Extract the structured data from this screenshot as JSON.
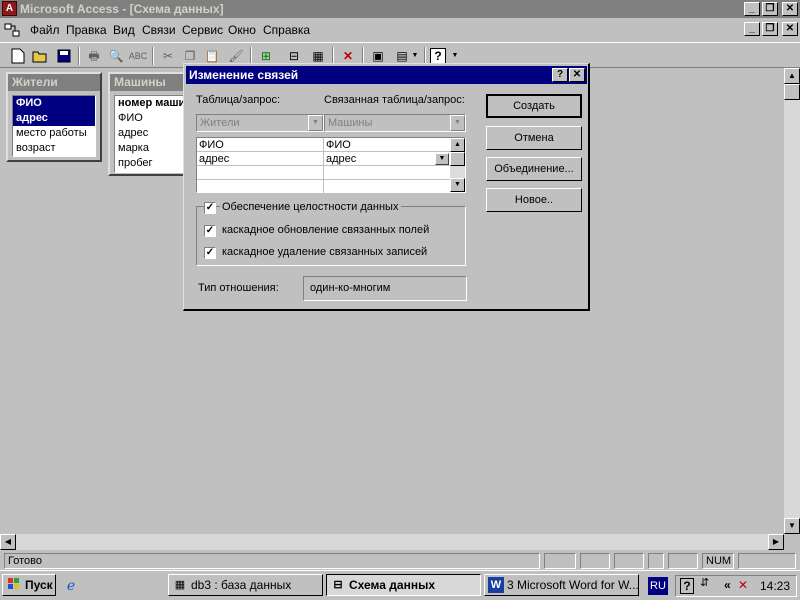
{
  "app": {
    "title": "Microsoft Access - [Схема данных]",
    "icon": "access-icon",
    "caption_buttons": [
      "_",
      "❐",
      "✕"
    ]
  },
  "menu": {
    "items": [
      "Файл",
      "Правка",
      "Вид",
      "Связи",
      "Сервис",
      "Окно",
      "Справка"
    ]
  },
  "toolbar": {
    "icons": [
      "new-icon",
      "open-icon",
      "save-icon",
      "print-icon",
      "print-preview-icon",
      "spelling-icon",
      "cut-icon",
      "copy-icon",
      "paste-icon",
      "format-painter-icon",
      "show-table-icon",
      "show-direct-icon",
      "show-all-icon",
      "delete-icon",
      "database-window-icon",
      "new-object-icon",
      "help-icon"
    ]
  },
  "tables": [
    {
      "name": "Жители",
      "fields": [
        "ФИО",
        "адрес",
        "место работы",
        "возраст"
      ],
      "selected": [
        0,
        1
      ]
    },
    {
      "name": "Машины",
      "fields": [
        "номер машины",
        "ФИО",
        "адрес",
        "марка",
        "пробег"
      ]
    }
  ],
  "dialog": {
    "title": "Изменение связей",
    "help_button": "?",
    "close_button": "✕",
    "table_label": "Таблица/запрос:",
    "related_label": "Связанная таблица/запрос:",
    "table_value": "Жители",
    "related_value": "Машины",
    "grid_rows": [
      [
        "ФИО",
        "ФИО"
      ],
      [
        "адрес",
        "адрес"
      ],
      [
        "",
        ""
      ],
      [
        "",
        ""
      ]
    ],
    "buttons": {
      "create": "Создать",
      "cancel": "Отмена",
      "join": "Объединение...",
      "new": "Новое.."
    },
    "integrity_label": "Обеспечение целостности данных",
    "cascade_update_label": "каскадное обновление связанных полей",
    "cascade_delete_label": "каскадное удаление связанных записей",
    "checked": {
      "integrity": true,
      "cascade_update": true,
      "cascade_delete": true
    },
    "relation_type_label": "Тип отношения:",
    "relation_type_value": "один-ко-многим"
  },
  "status": {
    "text": "Готово",
    "num": "NUM"
  },
  "taskbar": {
    "start": "Пуск",
    "tasks": [
      {
        "label": "db3 : база данных",
        "icon": "database-icon"
      },
      {
        "label": "Схема данных",
        "icon": "relationships-icon",
        "active": true
      },
      {
        "label": "3 Microsoft Word for W...",
        "icon": "word-icon"
      }
    ],
    "lang": "RU",
    "time": "14:23"
  }
}
